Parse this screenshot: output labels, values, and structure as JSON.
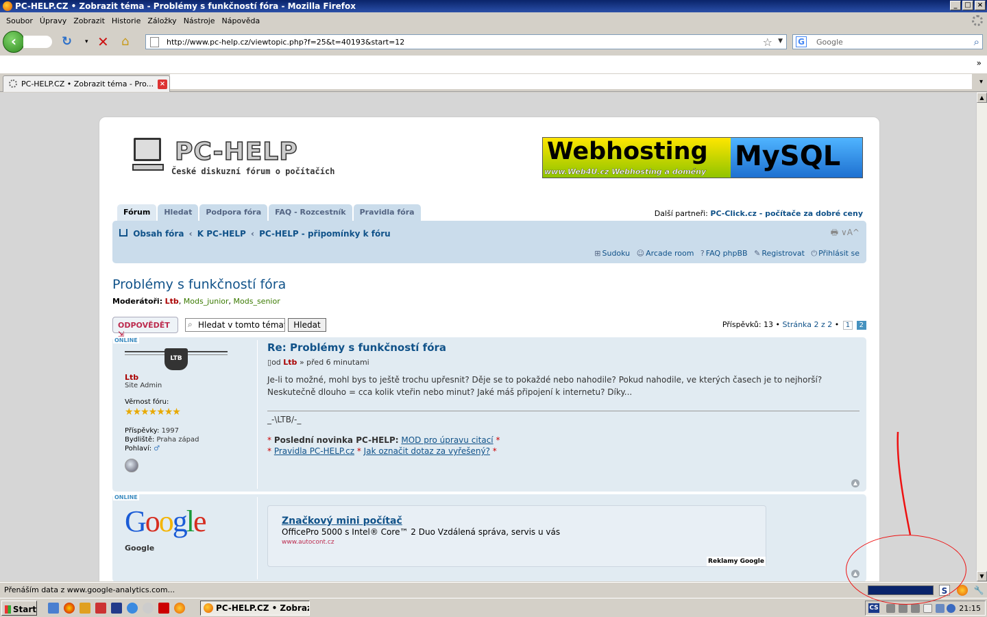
{
  "window": {
    "title": "PC-HELP.CZ • Zobrazit téma - Problémy s funkčností fóra - Mozilla Firefox"
  },
  "menu": [
    "Soubor",
    "Úpravy",
    "Zobrazit",
    "Historie",
    "Záložky",
    "Nástroje",
    "Nápověda"
  ],
  "navbar": {
    "url": "http://www.pc-help.cz/viewtopic.php?f=25&t=40193&start=12",
    "search_placeholder": "Google"
  },
  "tab": {
    "title": "PC-HELP.CZ • Zobrazit téma - Pro..."
  },
  "site": {
    "logo_name": "PC-HELP",
    "logo_tagline": "České diskuzní fórum o počítačích",
    "banner_left": "Webhosting",
    "banner_left_sub": "www.Web4U.cz  Webhosting a domény",
    "banner_right": "MySQL"
  },
  "forum_tabs": [
    "Fórum",
    "Hledat",
    "Podpora fóra",
    "FAQ - Rozcestník",
    "Pravidla fóra"
  ],
  "partners": {
    "label": "Další partneři:",
    "link": "PC-Click.cz - počítače za dobré ceny"
  },
  "breadcrumbs": [
    "Obsah fóra",
    "K PC-HELP",
    "PC-HELP - připomínky k fóru"
  ],
  "print_icons": "🖶 ∨A^",
  "nav_links": [
    "Sudoku",
    "Arcade room",
    "FAQ phpBB",
    "Registrovat",
    "Přihlásit se"
  ],
  "topic": {
    "title": "Problémy s funkčností fóra",
    "moderators_label": "Moderátoři:",
    "moderator_1": "Ltb",
    "moderator_2": "Mods_junior",
    "moderator_3": "Mods_senior"
  },
  "actions": {
    "reply": "ODPOVĚDĚT",
    "search_value": "Hledat v tomto tématu",
    "search_button": "Hledat",
    "posts_label": "Příspěvků: 13 •",
    "page_label": "Stránka 2 z 2",
    "bullet": "•",
    "page_1": "1",
    "page_2": "2"
  },
  "post1": {
    "online": "ONLINE",
    "avatar_text": "LTB",
    "username": "Ltb",
    "rank": "Site Admin",
    "fidelity_label": "Věrnost fóru:",
    "stars": "★★★★★★★",
    "posts_label": "Příspěvky:",
    "posts_value": "1997",
    "location_label": "Bydliště:",
    "location_value": "Praha západ",
    "gender_label": "Pohlaví:",
    "gender_icon": "♂",
    "title": "Re: Problémy s funkčností fóra",
    "meta_prefix": "od",
    "meta_user": "Ltb",
    "meta_time": "» před 6 minutami",
    "text": "Je-li to možné, mohl bys to ještě trochu upřesnit? Děje se to pokaždé nebo nahodile? Pokud nahodile, ve kterých časech je to nejhorší? Neskutečně dlouho = cca kolik vteřin nebo minut? Jaké máš připojení k internetu? Díky...",
    "sig_name": "_-\\LTB/-_",
    "sig_news_label": "Poslední novinka PC-HELP:",
    "sig_news_link": "MOD pro úpravu citací",
    "sig_rules_link": "Pravidla PC-HELP.cz",
    "sig_mark_link": "Jak označit dotaz za vyřešený?",
    "star": "*"
  },
  "post2": {
    "online": "ONLINE",
    "logo": "Google",
    "username": "Google",
    "ad_title": "Značkový mini počítač",
    "ad_desc": "OfficePro 5000 s Intel® Core™ 2 Duo Vzdálená správa, servis u vás",
    "ad_url": "www.autocont.cz",
    "ad_credit": "Reklamy Google"
  },
  "statusbar": {
    "text": "Přenáším data z www.google-analytics.com..."
  },
  "taskbar": {
    "start": "Start",
    "task": "PC-HELP.CZ • Zobrazit...",
    "lang": "CS",
    "clock": "21:15"
  },
  "colors": {
    "link": "#105289",
    "admin": "#aa0000",
    "moderator_group": "#3a7a00",
    "annotation": "#ee1111"
  }
}
